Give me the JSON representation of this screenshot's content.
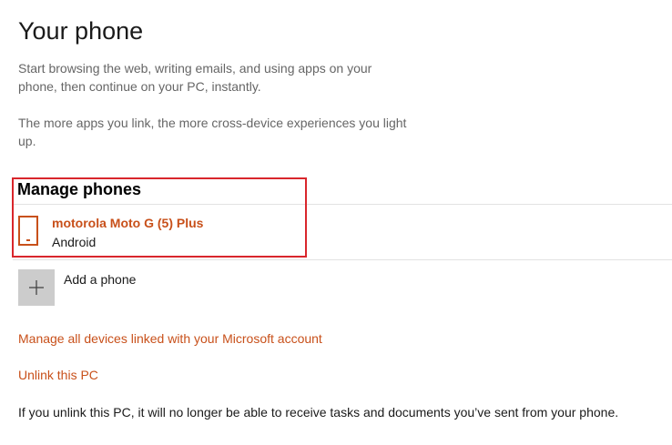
{
  "header": {
    "title": "Your phone"
  },
  "intro": {
    "paragraph1": "Start browsing the web, writing emails, and using apps on your phone, then continue on your PC, instantly.",
    "paragraph2": "The more apps you link, the more cross-device experiences you light up."
  },
  "manage_phones": {
    "heading": "Manage phones",
    "phones": [
      {
        "name": "motorola Moto G (5) Plus",
        "os": "Android"
      }
    ],
    "add_label": "Add a phone"
  },
  "links": {
    "manage_devices": "Manage all devices linked with your Microsoft account",
    "unlink": "Unlink this PC"
  },
  "footer": {
    "note": "If you unlink this PC, it will no longer be able to receive tasks and documents you’ve sent from your phone."
  },
  "colors": {
    "accent": "#c8501a",
    "highlight_border": "#d9262c",
    "add_tile": "#cccccc"
  },
  "icons": {
    "phone": "phone-icon",
    "add": "plus-icon"
  }
}
